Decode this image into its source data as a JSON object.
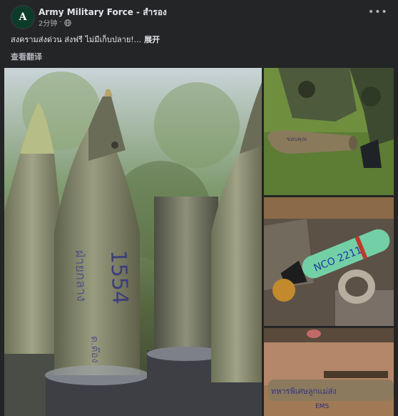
{
  "header": {
    "author": "Army Military Force - สำรอง",
    "time": "2分钟",
    "more_label": "•••",
    "avatar_letter": "A"
  },
  "post": {
    "caption": "สงครามส่งด่วน ส่งฟรี ไม่มีเก็บปลาย!...",
    "expand_label": "展开",
    "translate_label": "查看翻译"
  },
  "photos": {
    "main_marking_number": "1554",
    "shell_marking_2": "NCO 2211",
    "shell_marking_3": "EMS",
    "image_count": 4
  },
  "colors": {
    "background": "#242526",
    "text_primary": "#e4e6eb",
    "text_secondary": "#b0b3b8"
  }
}
